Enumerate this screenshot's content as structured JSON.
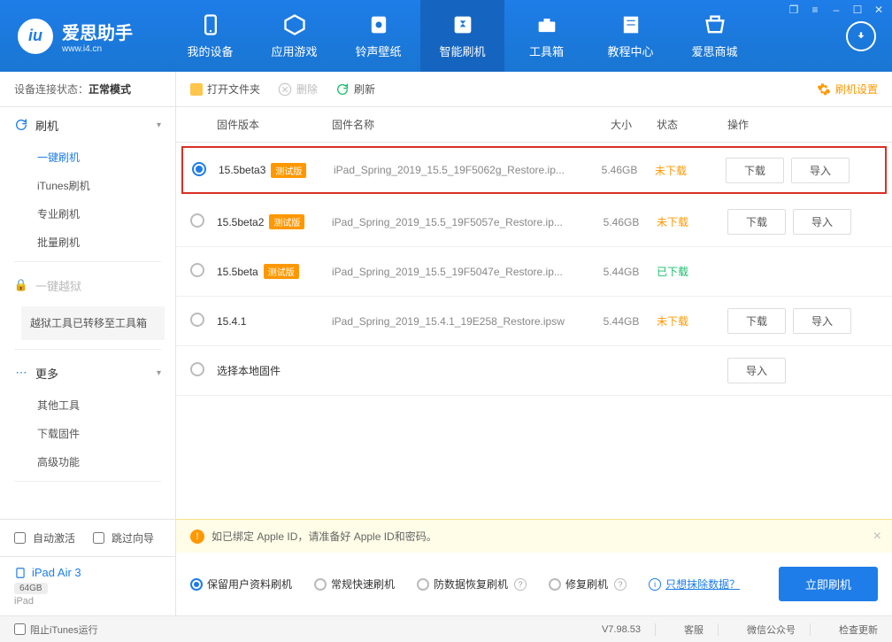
{
  "window_controls": [
    "❐",
    "≡",
    "–",
    "☐",
    "✕"
  ],
  "logo": {
    "title": "爱思助手",
    "subtitle": "www.i4.cn"
  },
  "nav": [
    {
      "label": "我的设备",
      "icon": "device"
    },
    {
      "label": "应用游戏",
      "icon": "apps"
    },
    {
      "label": "铃声壁纸",
      "icon": "music"
    },
    {
      "label": "智能刷机",
      "icon": "flash",
      "active": true
    },
    {
      "label": "工具箱",
      "icon": "toolbox"
    },
    {
      "label": "教程中心",
      "icon": "book"
    },
    {
      "label": "爱思商城",
      "icon": "store"
    }
  ],
  "sidebar": {
    "conn_label": "设备连接状态：",
    "conn_value": "正常模式",
    "menu": [
      {
        "type": "group",
        "icon": "↻",
        "label": "刷机",
        "exp": true,
        "items": [
          "一键刷机",
          "iTunes刷机",
          "专业刷机",
          "批量刷机"
        ],
        "active": 0
      },
      {
        "type": "disabled",
        "icon": "🔒",
        "label": "一键越狱",
        "note": "越狱工具已转移至工具箱"
      },
      {
        "type": "group",
        "icon": "⋯",
        "label": "更多",
        "exp": true,
        "items": [
          "其他工具",
          "下载固件",
          "高级功能"
        ]
      }
    ],
    "bottom": {
      "auto_activate": "自动激活",
      "skip_guide": "跳过向导",
      "device_name": "iPad Air 3",
      "device_storage": "64GB",
      "device_type": "iPad"
    }
  },
  "toolbar": {
    "open": "打开文件夹",
    "delete": "删除",
    "refresh": "刷新",
    "settings": "刷机设置"
  },
  "table": {
    "headers": {
      "ver": "固件版本",
      "name": "固件名称",
      "size": "大小",
      "status": "状态",
      "ops": "操作"
    },
    "rows": [
      {
        "selected": true,
        "highlight": true,
        "ver": "15.5beta3",
        "beta": true,
        "name": "iPad_Spring_2019_15.5_19F5062g_Restore.ip...",
        "size": "5.46GB",
        "status": "未下载",
        "status_type": "not",
        "download": true,
        "import": true
      },
      {
        "selected": false,
        "ver": "15.5beta2",
        "beta": true,
        "name": "iPad_Spring_2019_15.5_19F5057e_Restore.ip...",
        "size": "5.46GB",
        "status": "未下载",
        "status_type": "not",
        "download": true,
        "import": true
      },
      {
        "selected": false,
        "ver": "15.5beta",
        "beta": true,
        "name": "iPad_Spring_2019_15.5_19F5047e_Restore.ip...",
        "size": "5.44GB",
        "status": "已下载",
        "status_type": "done",
        "download": false,
        "import": false
      },
      {
        "selected": false,
        "ver": "15.4.1",
        "beta": false,
        "name": "iPad_Spring_2019_15.4.1_19E258_Restore.ipsw",
        "size": "5.44GB",
        "status": "未下载",
        "status_type": "not",
        "download": true,
        "import": true
      },
      {
        "selected": false,
        "ver": "选择本地固件",
        "beta": false,
        "name": "",
        "size": "",
        "status": "",
        "status_type": "",
        "download": false,
        "import": true,
        "local": true
      }
    ],
    "btn_download": "下载",
    "btn_import": "导入",
    "beta_tag": "测试版"
  },
  "alert": "如已绑定 Apple ID，请准备好 Apple ID和密码。",
  "flash_options": [
    {
      "label": "保留用户资料刷机",
      "q": false,
      "on": true
    },
    {
      "label": "常规快速刷机",
      "q": false,
      "on": false
    },
    {
      "label": "防数据恢复刷机",
      "q": true,
      "on": false
    },
    {
      "label": "修复刷机",
      "q": true,
      "on": false
    }
  ],
  "erase_link": "只想抹除数据？",
  "flash_button": "立即刷机",
  "footer": {
    "block_itunes": "阻止iTunes运行",
    "version": "V7.98.53",
    "cs": "客服",
    "wechat": "微信公众号",
    "update": "检查更新"
  }
}
